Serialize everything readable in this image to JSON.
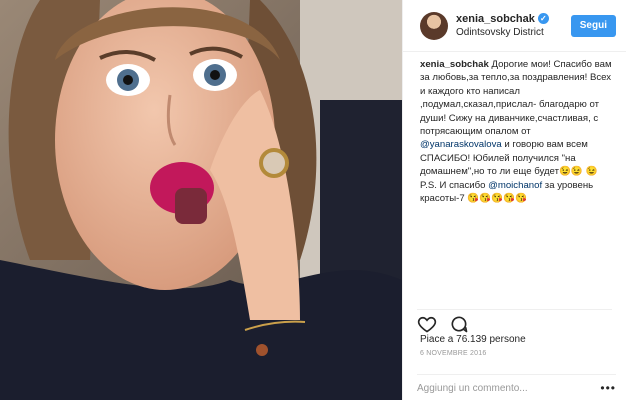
{
  "header": {
    "username": "xenia_sobchak",
    "location": "Odintsovsky District",
    "follow_label": "Segui"
  },
  "caption": {
    "username": "xenia_sobchak",
    "part1": " Дорогие мои! Спасибо вам за любовь,за тепло,за поздравления! Всех и каждого кто написал ,подумал,сказал,прислал- благодарю от души! Сижу на диванчике,счастливая, с потрясающим опалом от ",
    "mention1": "@yanaraskovalova",
    "part2": " и говорю вам всем СПАСИБО! Юбилей получился \"на домашнем\",но то ли еще будет😉😉 😉 P.S. И спасибо ",
    "mention2": "@moichanof",
    "part3": " за уровень красоты-7 😘😘😘😘😘"
  },
  "likes": "Piace a 76.139 persone",
  "date": "6 novembre 2016",
  "comment": {
    "placeholder": "Aggiungi un commento..."
  },
  "icons": {
    "like": "heart-icon",
    "comment": "speech-bubble-icon",
    "more": "more-dots-icon",
    "verified": "verified-badge-icon"
  },
  "colors": {
    "accent": "#3897f0",
    "text": "#262626",
    "muted": "#999999"
  }
}
